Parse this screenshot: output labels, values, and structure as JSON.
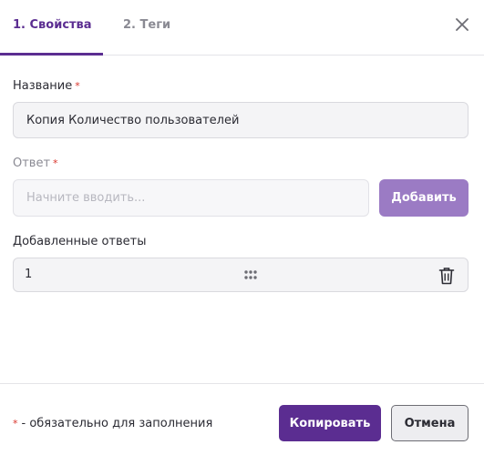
{
  "tabs": [
    {
      "label": "1. Свойства",
      "active": true
    },
    {
      "label": "2. Теги",
      "active": false
    }
  ],
  "icons": {
    "close": "close-icon",
    "drag": "drag-handle-icon",
    "trash": "trash-icon"
  },
  "colors": {
    "accent": "#5b2d91",
    "add_button": "#9b7bc4",
    "required": "#d9342b"
  },
  "form": {
    "name": {
      "label": "Название",
      "required_mark": "*",
      "value": "Копия Количество пользователей"
    },
    "answer": {
      "label": "Ответ",
      "required_mark": "*",
      "placeholder": "Начните вводить...",
      "add_label": "Добавить"
    },
    "added": {
      "label": "Добавленные ответы",
      "items": [
        {
          "value": "1"
        }
      ]
    }
  },
  "footer": {
    "required_mark": "*",
    "hint": "- обязательно для заполнения",
    "copy_label": "Копировать",
    "cancel_label": "Отмена"
  }
}
